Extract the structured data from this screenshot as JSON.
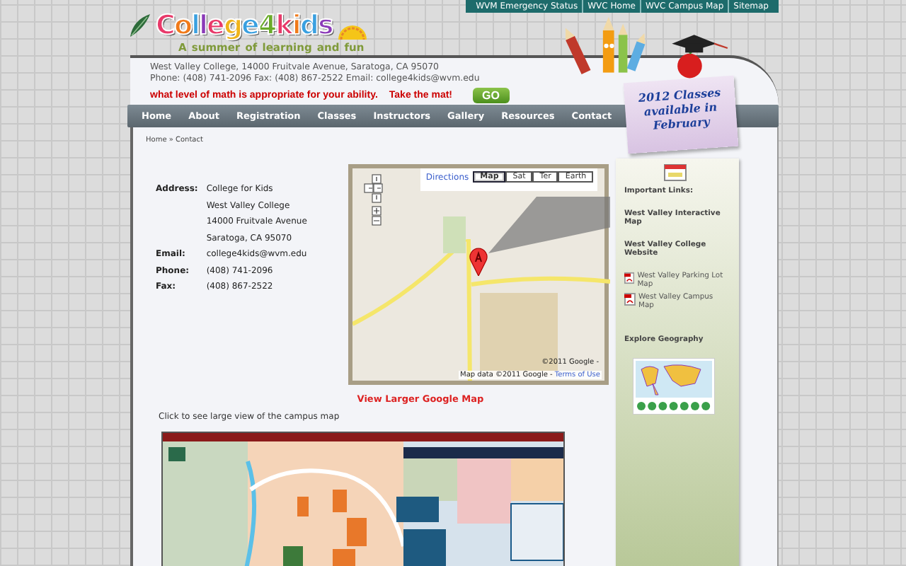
{
  "top_links": [
    "WVM Emergency Status",
    "WVC Home",
    "WVC Campus Map",
    "Sitemap"
  ],
  "header": {
    "logo": "College4kids",
    "tagline": "A summer of learning and fun",
    "address": "West Valley College, 14000 Fruitvale Avenue, Saratoga, CA 95070",
    "contact": "Phone: (408) 741-2096 Fax: (408) 867-2522 Email: college4kids@wvm.edu",
    "promo": "what level of math is appropriate for your ability.",
    "promo_link": "Take the mat!",
    "go_button": "GO"
  },
  "sticky_note": "2012 Classes available in February",
  "nav": [
    "Home",
    "About",
    "Registration",
    "Classes",
    "Instructors",
    "Gallery",
    "Resources",
    "Contact"
  ],
  "breadcrumb": "Home » Contact",
  "contact": [
    {
      "label": "Address:",
      "lines": [
        "College for Kids",
        "West Valley College",
        "14000 Fruitvale Avenue",
        "Saratoga, CA 95070"
      ]
    },
    {
      "label": "Email:",
      "lines": [
        "college4kids@wvm.edu"
      ]
    },
    {
      "label": "Phone:",
      "lines": [
        "(408) 741-2096"
      ]
    },
    {
      "label": "Fax:",
      "lines": [
        "(408) 867-2522"
      ]
    }
  ],
  "map": {
    "directions": "Directions",
    "map_types": [
      {
        "label": "Map",
        "selected": true
      },
      {
        "label": "Sat",
        "selected": false
      },
      {
        "label": "Ter",
        "selected": false
      },
      {
        "label": "Earth",
        "selected": false
      }
    ],
    "copyright": "©2011 Google -",
    "attribution": "Map data ©2011 Google -",
    "terms": "Terms of Use"
  },
  "view_larger": "View Larger Google Map",
  "campus_caption": "Click to see large view of the campus map",
  "sidebar": {
    "heading": "Important Links:",
    "links": [
      {
        "label": "West Valley Interactive Map",
        "kind": "text"
      },
      {
        "label": "West Valley College Website",
        "kind": "text"
      },
      {
        "label": "West Valley Parking Lot Map",
        "kind": "pdf"
      },
      {
        "label": "West Valley Campus Map",
        "kind": "pdf"
      }
    ],
    "geo_heading": "Explore Geography"
  }
}
